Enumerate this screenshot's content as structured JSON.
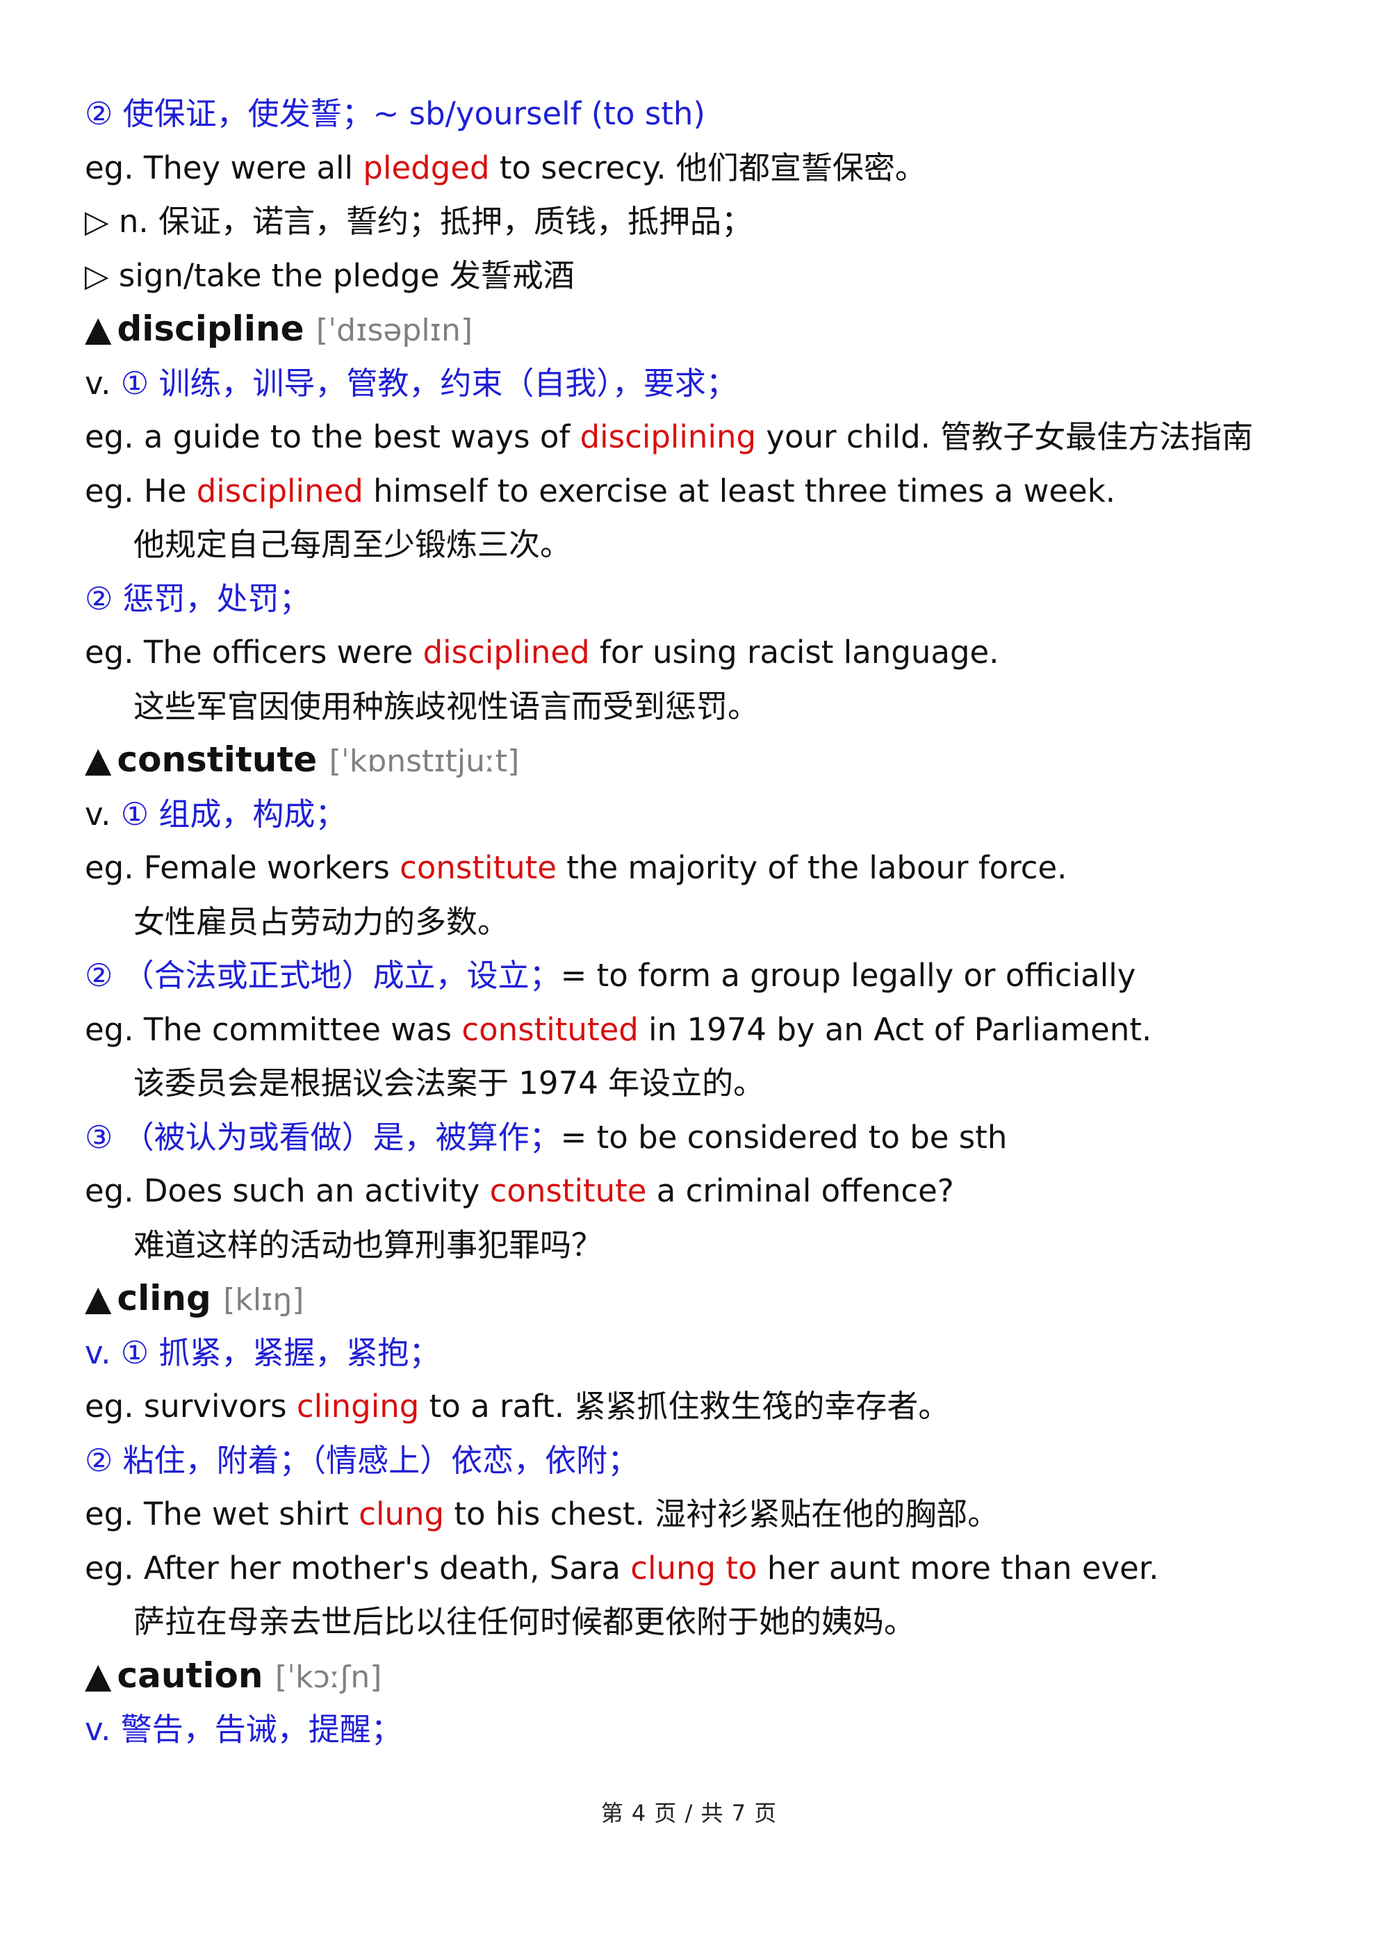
{
  "colors": {
    "sense": "#1f1fd6",
    "highlight": "#d80f0f",
    "phonetic": "#808080",
    "text": "#111111"
  },
  "entries": {
    "pledge": {
      "sense2": "② 使保证，使发誓；~ sb/yourself (to sth)",
      "ex1": {
        "pre": "eg. They were all ",
        "hl": "pledged",
        "post": " to secrecy.  他们都宣誓保密。"
      },
      "noun": "▷ n.  保证，诺言，誓约；抵押，质钱，抵押品；",
      "phrase": "▷ sign/take the pledge  发誓戒酒"
    },
    "discipline": {
      "word": "discipline",
      "phonetic": "[ˈdɪsəplɪn]",
      "pos": "v. ",
      "sense1": "① 训练，训导，管教，约束（自我），要求；",
      "ex1": {
        "pre": "eg. a guide to the best ways of ",
        "hl": "disciplining",
        "post": " your child.  管教子女最佳方法指南"
      },
      "ex2": {
        "pre": "eg. He ",
        "hl": "disciplined",
        "post": " himself to exercise at least three times a week."
      },
      "ex2_zh": "他规定自己每周至少锻炼三次。",
      "sense2": "② 惩罚，处罚；",
      "ex3": {
        "pre": "eg. The officers were ",
        "hl": "disciplined",
        "post": " for using racist language."
      },
      "ex3_zh": "这些军官因使用种族歧视性语言而受到惩罚。"
    },
    "constitute": {
      "word": "constitute",
      "phonetic": "[ˈkɒnstɪtjuːt]",
      "pos": "v. ",
      "sense1": "① 组成，构成；",
      "ex1": {
        "pre": "eg. Female workers ",
        "hl": "constitute",
        "post": " the majority of the labour force."
      },
      "ex1_zh": "女性雇员占劳动力的多数。",
      "sense2": "② （合法或正式地）成立，设立；",
      "sense2_en": "= to form a group legally or officially",
      "ex2": {
        "pre": "eg. The committee was ",
        "hl": "constituted",
        "post": " in 1974 by an Act of Parliament."
      },
      "ex2_zh": "该委员会是根据议会法案于 1974 年设立的。",
      "sense3": "③ （被认为或看做）是，被算作；",
      "sense3_en": "= to be considered to be sth",
      "ex3": {
        "pre": "eg. Does such an activity ",
        "hl": "constitute",
        "post": " a criminal offence?"
      },
      "ex3_zh": "难道这样的活动也算刑事犯罪吗？"
    },
    "cling": {
      "word": "cling",
      "phonetic": "[klɪŋ]",
      "sense1": "v. ① 抓紧，紧握，紧抱；",
      "ex1": {
        "pre": "eg. survivors ",
        "hl": "clinging",
        "post": " to a raft.  紧紧抓住救生筏的幸存者。"
      },
      "sense2": "② 粘住，附着；（情感上）依恋，依附；",
      "ex2": {
        "pre": "eg. The wet shirt ",
        "hl": "clung",
        "post": " to his chest.  湿衬衫紧贴在他的胸部。"
      },
      "ex3": {
        "pre": "eg. After her mother's death, Sara ",
        "hl": "clung to",
        "post": " her aunt more than ever."
      },
      "ex3_zh": "萨拉在母亲去世后比以往任何时候都更依附于她的姨妈。"
    },
    "caution": {
      "word": "caution",
      "phonetic": "[ˈkɔːʃn]",
      "sense1": "v.  警告，告诫，提醒；"
    }
  },
  "head_marker": "▲",
  "footer": "第 4 页 / 共 7 页"
}
